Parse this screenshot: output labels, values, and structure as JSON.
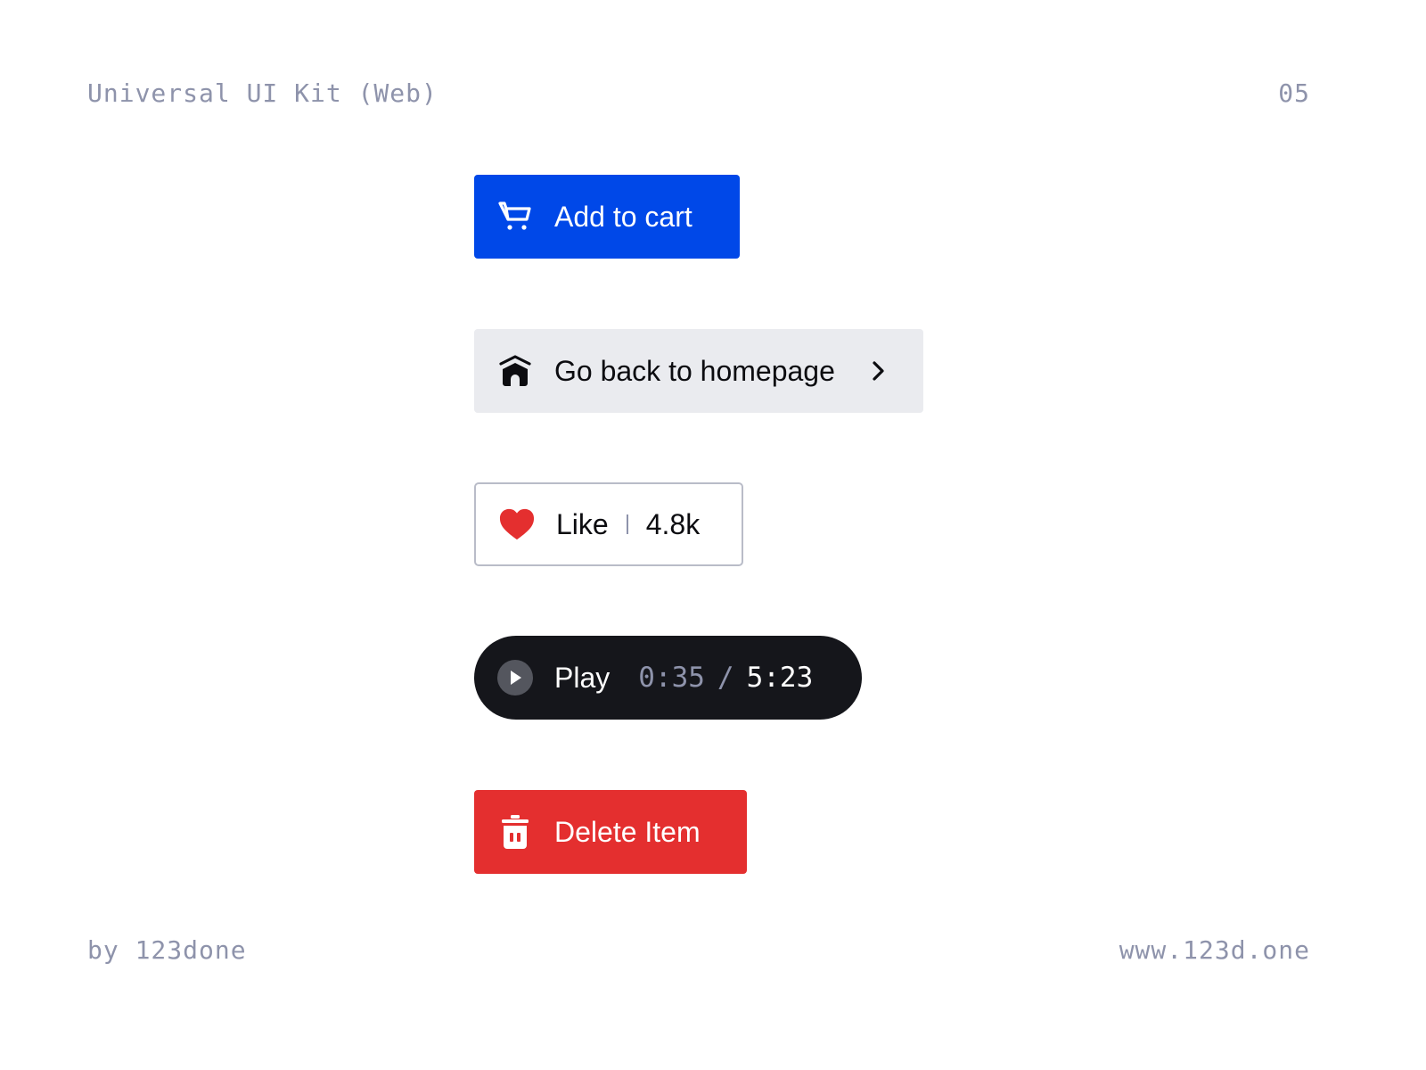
{
  "header": {
    "title": "Universal UI Kit (Web)",
    "page_number": "05"
  },
  "footer": {
    "author": "by 123done",
    "website": "www.123d.one"
  },
  "buttons": {
    "add_to_cart": {
      "label": "Add to cart",
      "icon": "cart-icon",
      "color": "#0048e8"
    },
    "go_home": {
      "label": "Go back to homepage",
      "icon": "home-icon",
      "trailing_icon": "chevron-right-icon",
      "color": "#eaebef"
    },
    "like": {
      "label": "Like",
      "count": "4.8k",
      "icon": "heart-icon",
      "icon_color": "#e42f2f"
    },
    "play": {
      "label": "Play",
      "current_time": "0:35",
      "separator": "/",
      "total_time": "5:23",
      "icon": "play-icon",
      "color": "#15161b"
    },
    "delete": {
      "label": "Delete Item",
      "icon": "trash-icon",
      "color": "#e42f2f"
    }
  }
}
